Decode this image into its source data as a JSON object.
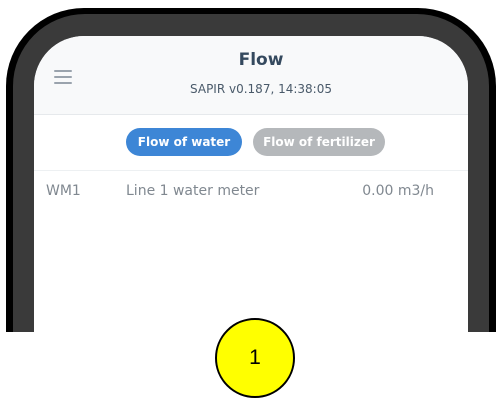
{
  "header": {
    "title": "Flow",
    "subtitle": "SAPIR v0.187, 14:38:05",
    "menu_icon": "hamburger-menu-icon"
  },
  "tabs": [
    {
      "label": "Flow of water",
      "selected": true,
      "color": "#3d86d6"
    },
    {
      "label": "Flow of fertilizer",
      "selected": false,
      "color": "#b5b8bb"
    }
  ],
  "meters": [
    {
      "id": "WM1",
      "name": "Line 1 water meter",
      "value": "0.00 m3/h"
    }
  ],
  "callout": {
    "number": "1",
    "color": "#ffff00"
  }
}
